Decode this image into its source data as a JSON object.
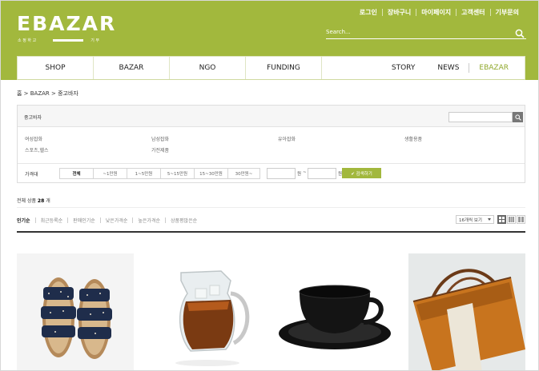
{
  "header": {
    "logo_text": "EBAZAR",
    "logo_sub_left": "소 정 하 고",
    "logo_sub_right": "기 부",
    "top_menu": [
      "로그인",
      "장바구니",
      "마이페이지",
      "고객센터",
      "기부문의"
    ],
    "search_placeholder": "Search..."
  },
  "nav": {
    "items": [
      "SHOP",
      "BAZAR",
      "NGO",
      "FUNDING"
    ],
    "right_items": [
      "STORY",
      "NEWS",
      "EBAZAR"
    ],
    "active": "EBAZAR"
  },
  "breadcrumb": "홈 > BAZAR > 중고바자",
  "filter": {
    "title": "중고바자",
    "categories": [
      "여성잡화",
      "남성잡화",
      "유아잡화",
      "생활용품",
      "스포츠,헬스",
      "가전제품"
    ],
    "price_label": "가격대",
    "price_buttons": [
      "전체",
      "~1만원",
      "1~5만원",
      "5~15만원",
      "15~30만원",
      "30만원~"
    ],
    "unit": "원",
    "tilde": "~",
    "search_button": "✔ 검색하기"
  },
  "total": {
    "prefix": "전체 상품",
    "count": "28",
    "suffix": "개"
  },
  "sort": {
    "items": [
      "인기순",
      "최근등록순",
      "판매인기순",
      "낮은가격순",
      "높은가격순",
      "상품평많은순"
    ],
    "active": "인기순",
    "view_option": "16개씩 보기"
  },
  "colors": {
    "brand": "#a2b83d",
    "accent_text": "#8fa82b"
  },
  "products": [
    {
      "icon": "sandals-image"
    },
    {
      "icon": "iced-tea-pitcher-image"
    },
    {
      "icon": "black-cup-image"
    },
    {
      "icon": "orange-bag-image"
    }
  ]
}
